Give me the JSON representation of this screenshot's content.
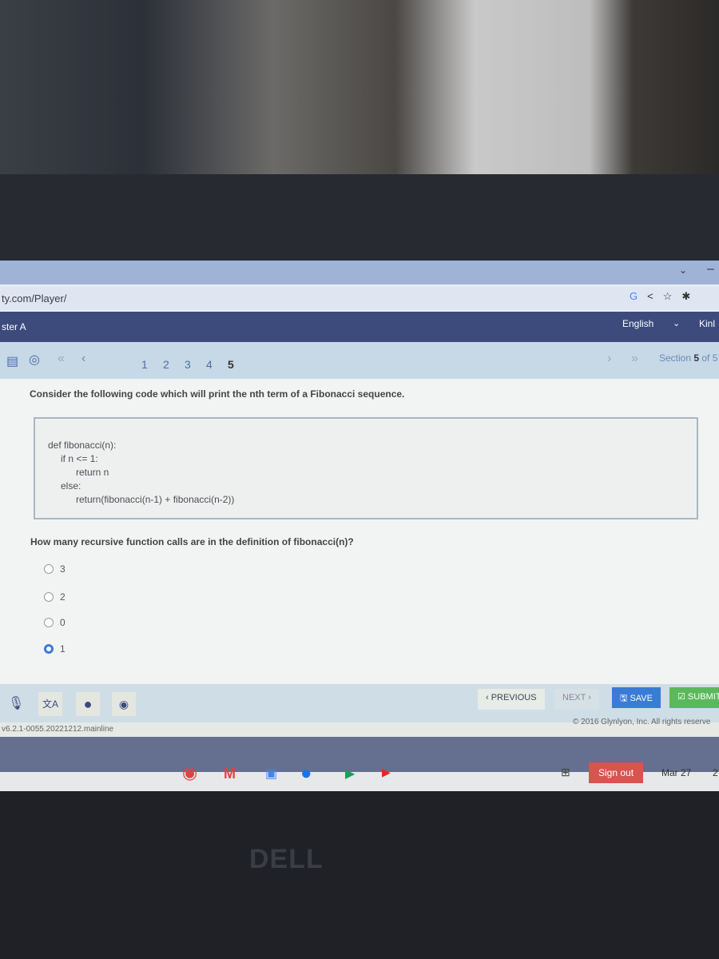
{
  "browser": {
    "url": "ty.com/Player/",
    "icons": [
      "google-icon",
      "share-icon",
      "star-icon",
      "extension-icon"
    ]
  },
  "nav": {
    "title": "ster A",
    "language": "English",
    "user": "Kinl"
  },
  "toolbar": {
    "pages": [
      "1",
      "2",
      "3",
      "4",
      "5"
    ],
    "current_page": "5",
    "section_prefix": "Section ",
    "section_num": "5",
    "section_suffix": " of 5"
  },
  "question": {
    "intro": "Consider the following code which will print the nth term of a Fibonacci sequence.",
    "code": [
      "def fibonacci(n):",
      "if n <= 1:",
      "return n",
      "else:",
      "return(fibonacci(n-1) + fibonacci(n-2))"
    ],
    "prompt": "How many recursive function calls are in the definition of fibonacci(n)?",
    "options": [
      {
        "label": "3",
        "selected": false
      },
      {
        "label": "2",
        "selected": false
      },
      {
        "label": "0",
        "selected": false
      },
      {
        "label": "1",
        "selected": true
      }
    ]
  },
  "actions": {
    "previous": "‹ PREVIOUS",
    "next": "NEXT ›",
    "save": "SAVE",
    "submit": "SUBMIT"
  },
  "footer": {
    "version": "v6.2.1-0055.20221212.mainline",
    "copyright": "© 2016 Glynlyon, Inc. All rights reserve"
  },
  "shelf": {
    "sign_out": "Sign out",
    "date": "Mar 27",
    "time": "2"
  },
  "colors": {
    "nav": "#3c4a7c",
    "save": "#3a7bd5",
    "submit": "#5cb85c",
    "sign_out": "#d9534f"
  },
  "bezel": {
    "logo": "DELL"
  }
}
